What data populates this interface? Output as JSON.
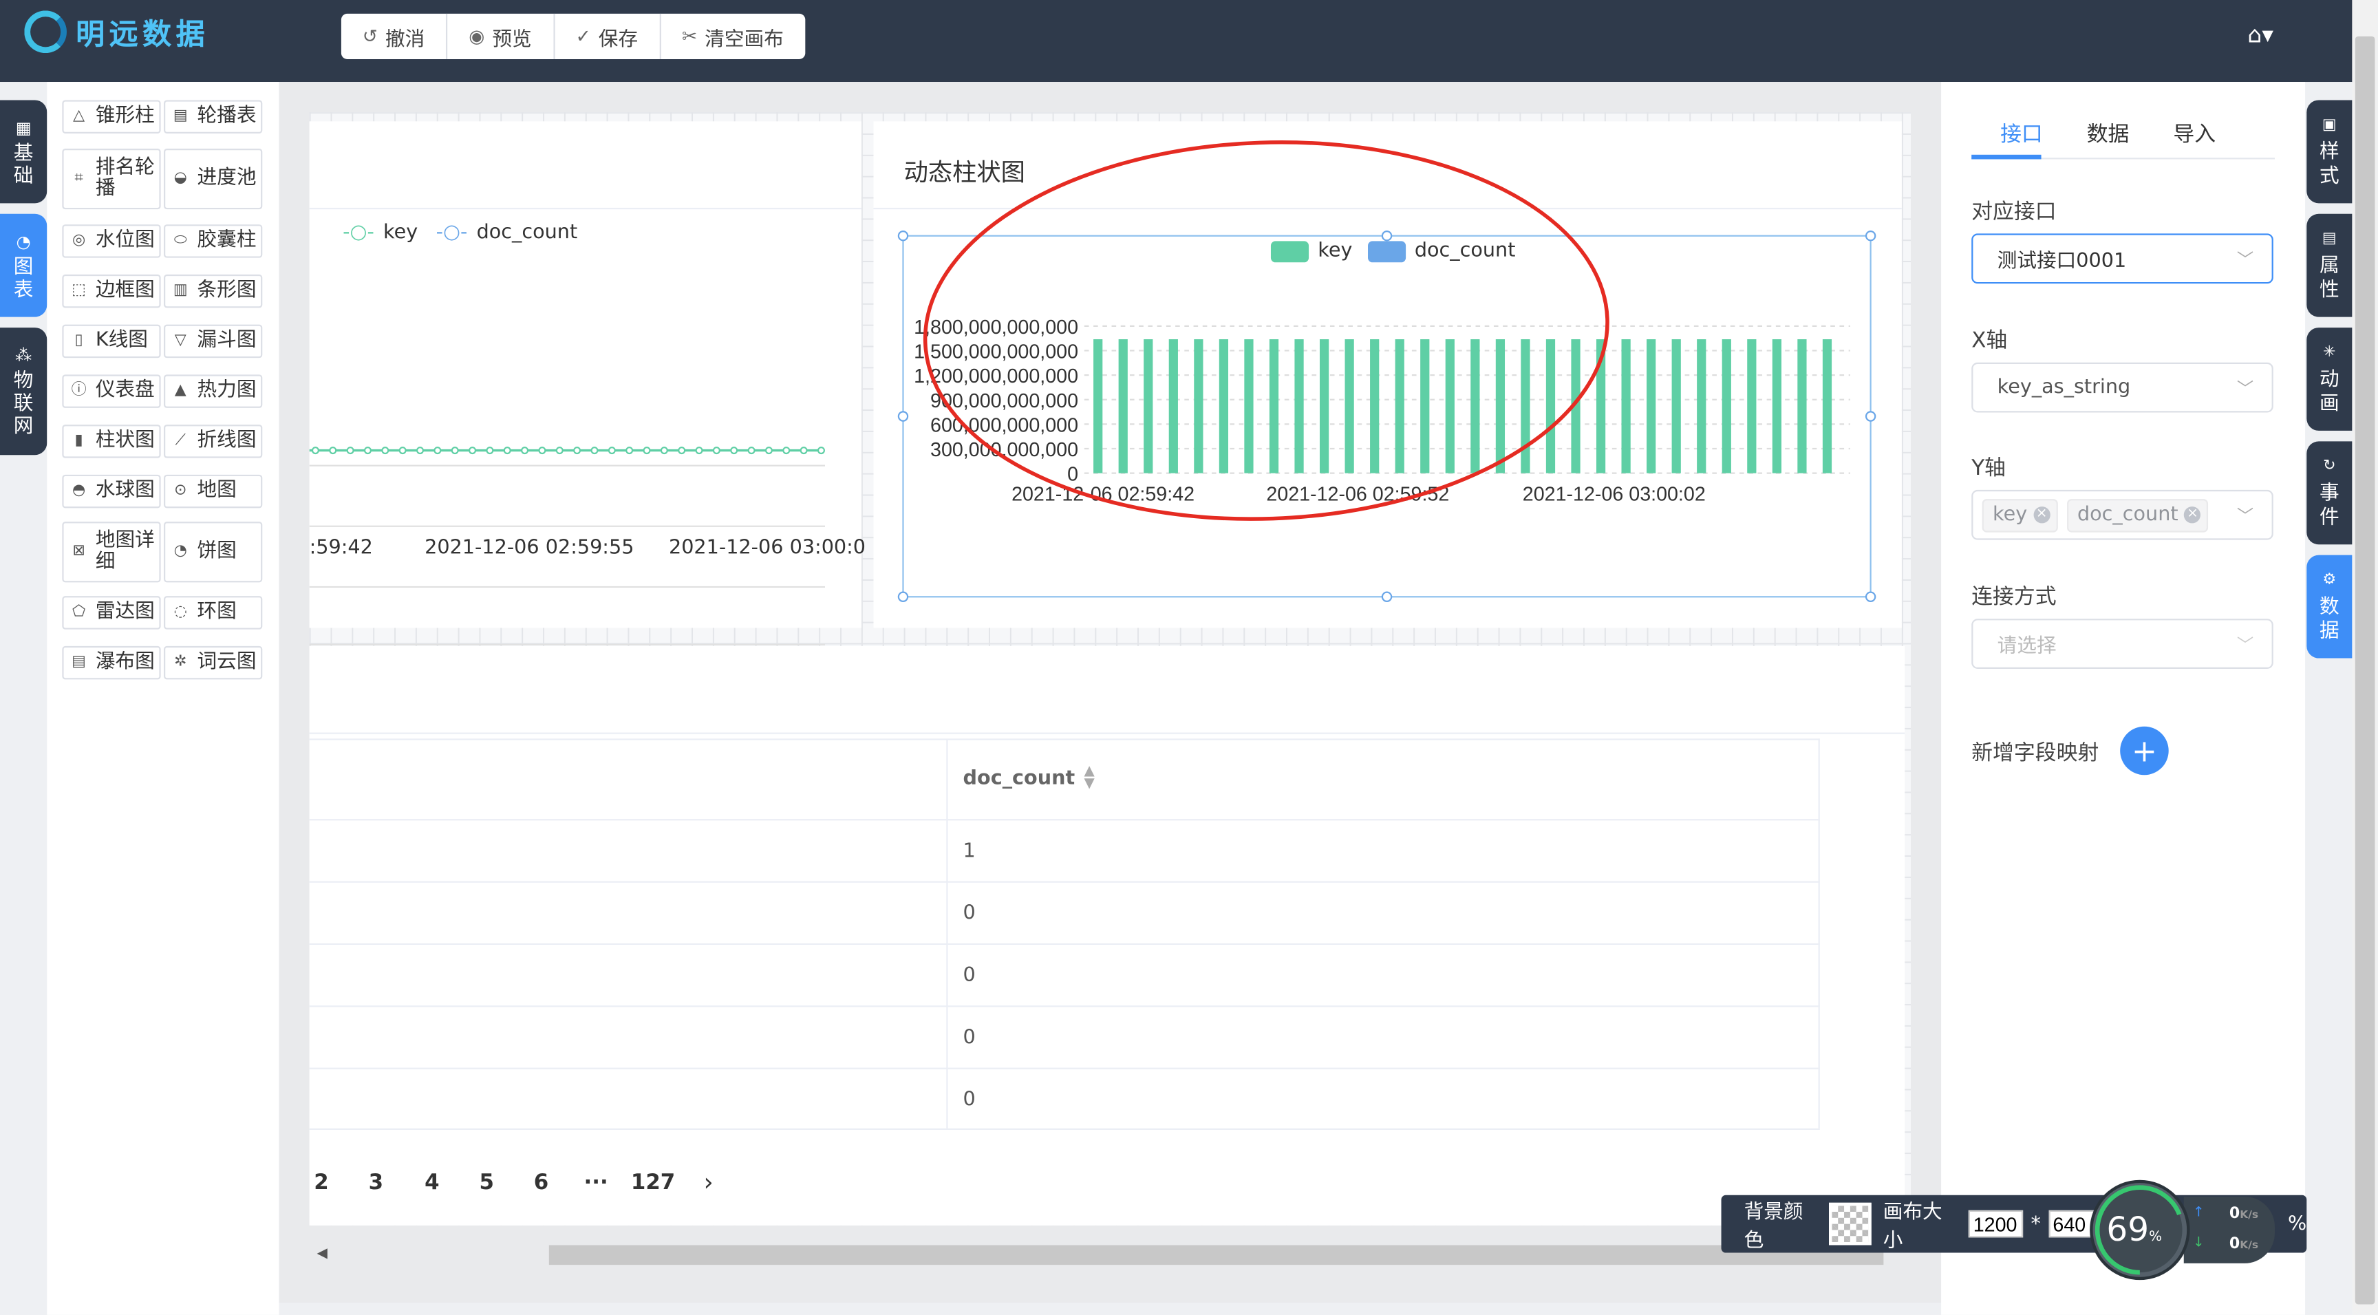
{
  "app": {
    "logo_text": "明远数据",
    "home_caret": "▾"
  },
  "toolbar": {
    "undo": "撤消",
    "preview": "预览",
    "save": "保存",
    "clear": "清空画布"
  },
  "left_tabs": [
    {
      "label": "基础",
      "icon": "grid-icon"
    },
    {
      "label": "图表",
      "icon": "chart-icon"
    },
    {
      "label": "物联网",
      "icon": "network-icon"
    }
  ],
  "palette": [
    {
      "label": "锥形柱",
      "icon": "cone-icon"
    },
    {
      "label": "轮播表",
      "icon": "carousel-table-icon"
    },
    {
      "label": "排名轮播",
      "icon": "ranking-icon"
    },
    {
      "label": "进度池",
      "icon": "progress-pool-icon"
    },
    {
      "label": "水位图",
      "icon": "water-level-icon"
    },
    {
      "label": "胶囊柱",
      "icon": "capsule-icon"
    },
    {
      "label": "边框图",
      "icon": "border-icon"
    },
    {
      "label": "条形图",
      "icon": "bar-icon"
    },
    {
      "label": "K线图",
      "icon": "candlestick-icon"
    },
    {
      "label": "漏斗图",
      "icon": "funnel-icon"
    },
    {
      "label": "仪表盘",
      "icon": "gauge-icon"
    },
    {
      "label": "热力图",
      "icon": "heatmap-icon"
    },
    {
      "label": "柱状图",
      "icon": "column-icon"
    },
    {
      "label": "折线图",
      "icon": "line-icon"
    },
    {
      "label": "水球图",
      "icon": "liquid-icon"
    },
    {
      "label": "地图",
      "icon": "map-pin-icon"
    },
    {
      "label": "地图详细",
      "icon": "map-detail-icon"
    },
    {
      "label": "饼图",
      "icon": "pie-icon"
    },
    {
      "label": "雷达图",
      "icon": "radar-icon"
    },
    {
      "label": "环图",
      "icon": "ring-icon"
    },
    {
      "label": "瀑布图",
      "icon": "waterfall-icon"
    },
    {
      "label": "词云图",
      "icon": "wordcloud-icon"
    }
  ],
  "line_widget": {
    "legend": [
      "key",
      "doc_count"
    ],
    "x_labels": [
      ":59:42",
      "2021-12-06 02:59:55",
      "2021-12-06 03:00:0"
    ]
  },
  "bar_widget": {
    "title": "动态柱状图"
  },
  "chart_data": {
    "type": "bar",
    "legend": [
      "key",
      "doc_count"
    ],
    "y_ticks": [
      "1,800,000,000,000",
      "1,500,000,000,000",
      "1,200,000,000,000",
      "900,000,000,000",
      "600,000,000,000",
      "300,000,000,000",
      "0"
    ],
    "ylim": [
      0,
      1800000000000
    ],
    "x_labels": [
      "2021-12-06 02:59:42",
      "2021-12-06 02:59:52",
      "2021-12-06 03:00:02"
    ],
    "series": [
      {
        "name": "key",
        "values": [
          1638800000000,
          1638800000000,
          1638800000000,
          1638800000000,
          1638800000000,
          1638800000000,
          1638800000000,
          1638800000000,
          1638800000000,
          1638800000000,
          1638800000000,
          1638800000000,
          1638800000000,
          1638800000000,
          1638800000000,
          1638800000000,
          1638800000000,
          1638800000000,
          1638800000000,
          1638800000000,
          1638800000000,
          1638800000000,
          1638800000000,
          1638800000000,
          1638800000000,
          1638800000000,
          1638800000000,
          1638800000000,
          1638800000000,
          1638800000000
        ]
      },
      {
        "name": "doc_count",
        "values": [
          1,
          0,
          0,
          0,
          0,
          0,
          0,
          0,
          0,
          0,
          0,
          0,
          0,
          0,
          0,
          0,
          0,
          0,
          0,
          0,
          0,
          0,
          0,
          0,
          0,
          0,
          0,
          0,
          0,
          0
        ]
      }
    ],
    "colors": [
      "#5fcfa5",
      "#6aa6e8"
    ]
  },
  "table": {
    "column": "doc_count",
    "rows": [
      "1",
      "0",
      "0",
      "0",
      "0"
    ],
    "pages": [
      "2",
      "3",
      "4",
      "5",
      "6",
      "···",
      "127"
    ],
    "next": "›"
  },
  "right_panel": {
    "tabs": [
      "接口",
      "数据",
      "导入"
    ],
    "interface_label": "对应接口",
    "interface_value": "测试接口0001",
    "x_label": "X轴",
    "x_value": "key_as_string",
    "y_label": "Y轴",
    "y_tags": [
      "key",
      "doc_count"
    ],
    "conn_label": "连接方式",
    "conn_placeholder": "请选择",
    "add_mapping_label": "新增字段映射",
    "add_symbol": "+"
  },
  "right_tabs": [
    {
      "label": "样式",
      "icon": "style-icon"
    },
    {
      "label": "属性",
      "icon": "property-icon"
    },
    {
      "label": "动画",
      "icon": "animation-icon"
    },
    {
      "label": "事件",
      "icon": "event-icon"
    },
    {
      "label": "数据",
      "icon": "data-icon"
    }
  ],
  "bottom_bar": {
    "bg_label": "背景颜色",
    "size_label": "画布大小",
    "width": "1200",
    "times": "*",
    "height": "640",
    "percent": "%"
  },
  "speed_widget": {
    "percent": "69",
    "unit": "%",
    "up": "0",
    "down": "0",
    "rate_unit": "K/s"
  }
}
